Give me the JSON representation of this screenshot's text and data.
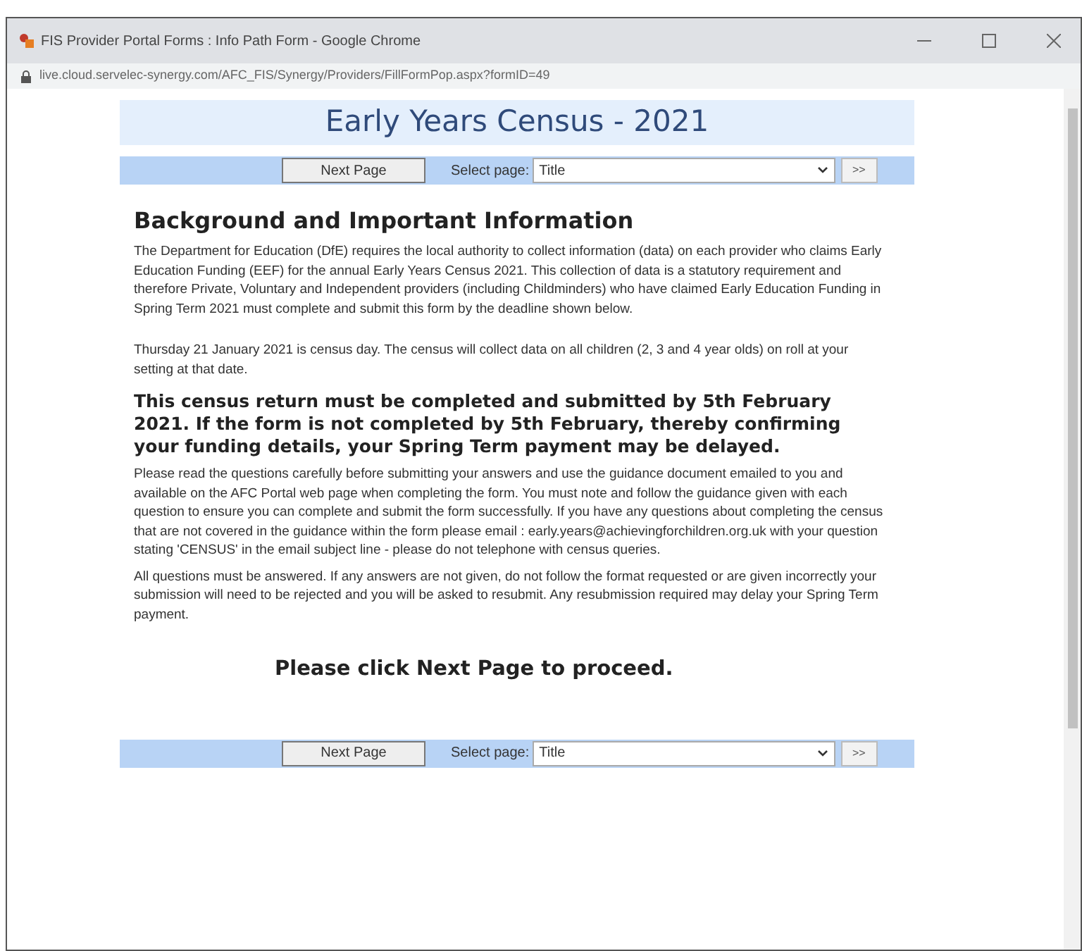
{
  "window": {
    "title": "FIS Provider Portal Forms : Info Path Form - Google Chrome",
    "url": "live.cloud.servelec-synergy.com/AFC_FIS/Synergy/Providers/FillFormPop.aspx?formID=49"
  },
  "form": {
    "title": "Early Years Census - 2021",
    "nav_top": {
      "next_button": "Next Page",
      "select_label": "Select page:",
      "select_value": "Title",
      "go_button": ">>"
    },
    "heading": "Background and Important Information",
    "paragraphs": [
      {
        "kind": "normal",
        "text": "The Department for Education (DfE) requires the local authority to collect information (data) on each provider who claims Early Education Funding (EEF) for the annual Early Years Census 2021. This collection of data is a statutory requirement and therefore Private, Voluntary and Independent providers (including Childminders) who have claimed Early Education Funding in Spring Term 2021 must complete and submit this form by the deadline shown below."
      },
      {
        "kind": "normal",
        "text": "Thursday 21 January 2021 is census day. The census will collect data on all children (2, 3 and 4 year olds) on roll at your setting at that date."
      },
      {
        "kind": "bold",
        "text": "This census return must be completed and submitted by 5th February 2021. If the form is not completed by 5th February, thereby confirming your funding details, your Spring Term payment may be delayed."
      },
      {
        "kind": "normal",
        "text": "Please read the questions carefully before submitting your answers and use the guidance document emailed to you and available on the AFC Portal web page when completing the form. You must note and follow the guidance given with each question to ensure you can complete and submit the form successfully. If you have any questions about completing the census that are not covered in the guidance within the form please email : early.years@achievingforchildren.org.uk with your question stating 'CENSUS' in the email subject line - please do not telephone with census queries."
      },
      {
        "kind": "normal",
        "text": "All questions must be answered. If any answers are not given, do not follow the format requested or are given incorrectly your submission will need to be rejected and you will be asked to resubmit. Any resubmission required may delay your Spring Term payment."
      }
    ],
    "proceed": "Please click Next Page to proceed.",
    "nav_bottom": {
      "next_button": "Next Page",
      "select_label": "Select page:",
      "select_value": "Title",
      "go_button": ">>"
    }
  }
}
